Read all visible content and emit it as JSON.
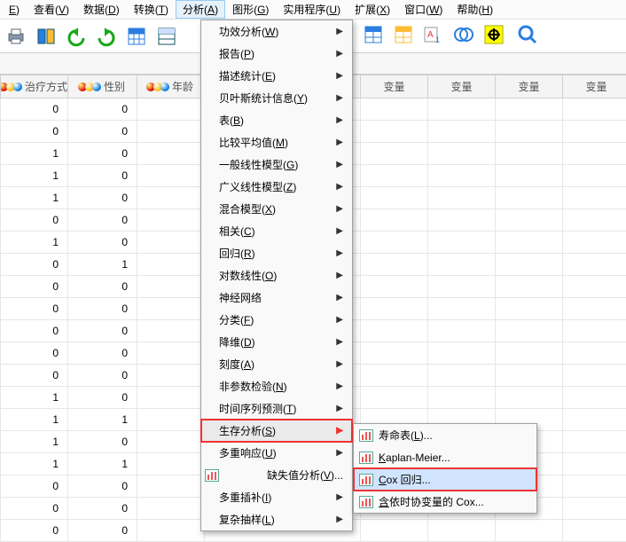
{
  "menubar": [
    {
      "pre": "",
      "u": "E",
      "post": ")"
    },
    {
      "pre": "查看(",
      "u": "V",
      "post": ")"
    },
    {
      "pre": "数据(",
      "u": "D",
      "post": ")"
    },
    {
      "pre": "转换(",
      "u": "T",
      "post": ")"
    },
    {
      "pre": "分析(",
      "u": "A",
      "post": ")",
      "open": true
    },
    {
      "pre": "图形(",
      "u": "G",
      "post": ")"
    },
    {
      "pre": "实用程序(",
      "u": "U",
      "post": ")"
    },
    {
      "pre": "扩展(",
      "u": "X",
      "post": ")"
    },
    {
      "pre": "窗口(",
      "u": "W",
      "post": ")"
    },
    {
      "pre": "帮助(",
      "u": "H",
      "post": ")"
    }
  ],
  "columns": [
    "治疗方式",
    "性别",
    "年龄",
    "",
    "变量",
    "变量",
    "变量",
    "变量"
  ],
  "rows": [
    [
      0,
      0,
      "",
      "",
      "",
      "",
      "",
      ""
    ],
    [
      0,
      0,
      "",
      "",
      "",
      "",
      "",
      ""
    ],
    [
      1,
      0,
      "",
      "",
      "",
      "",
      "",
      ""
    ],
    [
      1,
      0,
      "",
      "",
      "",
      "",
      "",
      ""
    ],
    [
      1,
      0,
      "",
      "",
      "",
      "",
      "",
      ""
    ],
    [
      0,
      0,
      "",
      "",
      "",
      "",
      "",
      ""
    ],
    [
      1,
      0,
      "",
      "",
      "",
      "",
      "",
      ""
    ],
    [
      0,
      1,
      "",
      "",
      "",
      "",
      "",
      ""
    ],
    [
      0,
      0,
      "",
      "",
      "",
      "",
      "",
      ""
    ],
    [
      0,
      0,
      "",
      "",
      "",
      "",
      "",
      ""
    ],
    [
      0,
      0,
      "",
      "",
      "",
      "",
      "",
      ""
    ],
    [
      0,
      0,
      "",
      "",
      "",
      "",
      "",
      ""
    ],
    [
      0,
      0,
      "",
      "",
      "",
      "",
      "",
      ""
    ],
    [
      1,
      0,
      "",
      "",
      "",
      "",
      "",
      ""
    ],
    [
      1,
      1,
      "",
      "",
      "",
      "",
      "",
      ""
    ],
    [
      1,
      0,
      "",
      "",
      "",
      "",
      "",
      ""
    ],
    [
      1,
      1,
      "",
      "",
      "",
      "",
      "",
      ""
    ],
    [
      0,
      0,
      "",
      "",
      "",
      "",
      "",
      ""
    ],
    [
      0,
      0,
      "",
      "",
      "",
      "",
      "",
      ""
    ],
    [
      0,
      0,
      "",
      "",
      "",
      "",
      "",
      ""
    ]
  ],
  "dropdown": [
    {
      "label": "功效分析(W)",
      "sub": true
    },
    {
      "label": "报告(P)",
      "sub": true
    },
    {
      "label": "描述统计(E)",
      "sub": true
    },
    {
      "label": "贝叶斯统计信息(Y)",
      "sub": true
    },
    {
      "label": "表(B)",
      "sub": true
    },
    {
      "label": "比较平均值(M)",
      "sub": true
    },
    {
      "label": "一般线性模型(G)",
      "sub": true
    },
    {
      "label": "广义线性模型(Z)",
      "sub": true
    },
    {
      "label": "混合模型(X)",
      "sub": true
    },
    {
      "label": "相关(C)",
      "sub": true
    },
    {
      "label": "回归(R)",
      "sub": true
    },
    {
      "label": "对数线性(O)",
      "sub": true
    },
    {
      "label": "神经网络",
      "sub": true
    },
    {
      "label": "分类(F)",
      "sub": true
    },
    {
      "label": "降维(D)",
      "sub": true
    },
    {
      "label": "刻度(A)",
      "sub": true
    },
    {
      "label": "非参数检验(N)",
      "sub": true
    },
    {
      "label": "时间序列预测(T)",
      "sub": true
    },
    {
      "label": "生存分析(S)",
      "sub": true,
      "sel": true
    },
    {
      "label": "多重响应(U)",
      "sub": true
    },
    {
      "label": "缺失值分析(V)...",
      "sub": false,
      "icon": true
    },
    {
      "label": "多重插补(I)",
      "sub": true
    },
    {
      "label": "复杂抽样(L)",
      "sub": true
    }
  ],
  "submenu": [
    {
      "label": "寿命表(L)..."
    },
    {
      "label": "Kaplan-Meier..."
    },
    {
      "label": "Cox 回归...",
      "hl": true
    },
    {
      "label": "含依时协变量的 Cox..."
    }
  ]
}
